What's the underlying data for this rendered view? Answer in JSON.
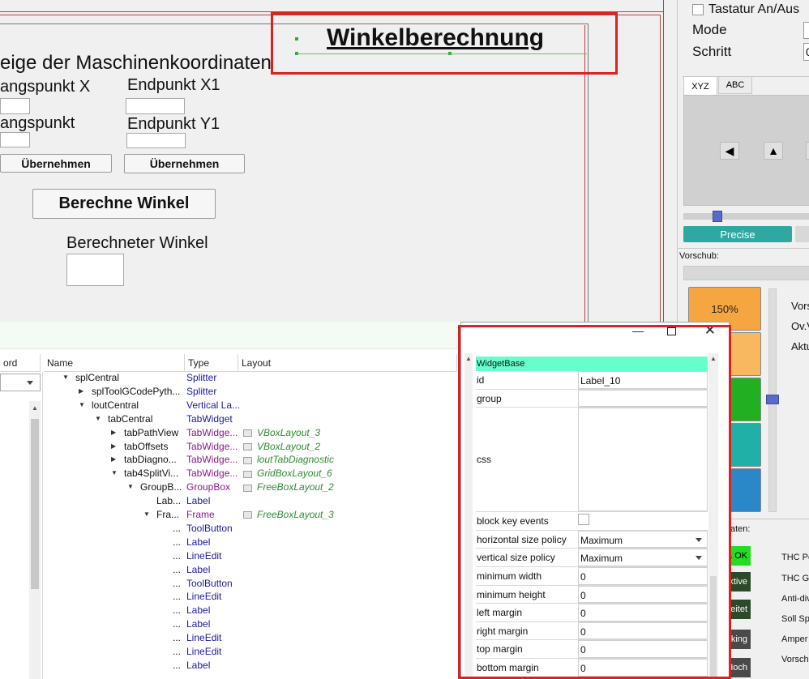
{
  "form": {
    "title": "Winkelberechnung",
    "section_heading": "eige der Maschinenkoordinaten",
    "start_x_label": "angspunkt X",
    "end_x_label": "Endpunkt X1",
    "start_y_label": "angspunkt",
    "end_y_label": "Endpunkt Y1",
    "apply_left_label": "Übernehmen",
    "apply_right_label": "Übernehmen",
    "calculate_label": "Berechne Winkel",
    "result_label": "Berechneter Winkel"
  },
  "machine_panel": {
    "keyboard_toggle_label": "Tastatur An/Aus",
    "mode_label": "Mode",
    "step_label": "Schritt",
    "step_value": "0",
    "tabs": [
      "XYZ",
      "ABC"
    ],
    "precise_label": "Precise",
    "feed_label": "Vorschub:",
    "overrides": [
      "150%",
      "%",
      "%",
      "%",
      "%"
    ],
    "side_labels": [
      "Vors",
      "Ov.V",
      "Aktu"
    ],
    "data_label": "aten:",
    "thc_status": [
      {
        "text": "a OK",
        "label": "THC Po"
      },
      {
        "text": "ist Aktive",
        "label": "THC Ge"
      },
      {
        "text": "rbeitet",
        "label": "Anti-div"
      },
      {
        "text": "s blocking",
        "label": "Soll Spa"
      },
      {
        "text": "r Hoch",
        "label": "Amper"
      },
      {
        "text": "",
        "label": "Vorsch"
      }
    ],
    "colors": {
      "accent": "#2ea8a0",
      "green": "#22c022",
      "orange": "#f5a640",
      "teal": "#20b0a8",
      "blue": "#2a88c8"
    }
  },
  "inspector": {
    "columns": [
      "ord",
      "Name",
      "Type",
      "Layout"
    ],
    "tree": [
      {
        "indent": 0,
        "arrow": "down",
        "name": "splCentral",
        "type": "Splitter",
        "type_color": "#1a1aa0",
        "layout": ""
      },
      {
        "indent": 1,
        "arrow": "right",
        "name": "splToolGCodePyth...",
        "type": "Splitter",
        "type_color": "#1a1aa0",
        "layout": ""
      },
      {
        "indent": 1,
        "arrow": "down",
        "name": "loutCentral",
        "type": "Vertical La...",
        "type_color": "#1a1aa0",
        "layout": ""
      },
      {
        "indent": 2,
        "arrow": "down",
        "name": "tabCentral",
        "type": "TabWidget",
        "type_color": "#1a1aa0",
        "layout": ""
      },
      {
        "indent": 3,
        "arrow": "right",
        "name": "tabPathView",
        "type": "TabWidge...",
        "type_color": "#8a1a8a",
        "layout": "VBoxLayout_3"
      },
      {
        "indent": 3,
        "arrow": "right",
        "name": "tabOffsets",
        "type": "TabWidge...",
        "type_color": "#8a1a8a",
        "layout": "VBoxLayout_2"
      },
      {
        "indent": 3,
        "arrow": "right",
        "name": "tabDiagno...",
        "type": "TabWidge...",
        "type_color": "#8a1a8a",
        "layout": "loutTabDiagnostic"
      },
      {
        "indent": 3,
        "arrow": "down",
        "name": "tab4SplitVi...",
        "type": "TabWidge...",
        "type_color": "#8a1a8a",
        "layout": "GridBoxLayout_6"
      },
      {
        "indent": 4,
        "arrow": "down",
        "name": "GroupB...",
        "type": "GroupBox",
        "type_color": "#8a1a8a",
        "layout": "FreeBoxLayout_2"
      },
      {
        "indent": 5,
        "arrow": "",
        "name": "Lab...",
        "type": "Label",
        "type_color": "#1a1aa0",
        "layout": ""
      },
      {
        "indent": 5,
        "arrow": "down",
        "name": "Fra...",
        "type": "Frame",
        "type_color": "#8a1a8a",
        "layout": "FreeBoxLayout_3"
      },
      {
        "indent": 6,
        "arrow": "",
        "name": "...",
        "type": "ToolButton",
        "type_color": "#1a1aa0",
        "layout": ""
      },
      {
        "indent": 6,
        "arrow": "",
        "name": "...",
        "type": "Label",
        "type_color": "#1a1aa0",
        "layout": ""
      },
      {
        "indent": 6,
        "arrow": "",
        "name": "...",
        "type": "LineEdit",
        "type_color": "#1a1aa0",
        "layout": ""
      },
      {
        "indent": 6,
        "arrow": "",
        "name": "...",
        "type": "Label",
        "type_color": "#1a1aa0",
        "layout": ""
      },
      {
        "indent": 6,
        "arrow": "",
        "name": "...",
        "type": "ToolButton",
        "type_color": "#1a1aa0",
        "layout": ""
      },
      {
        "indent": 6,
        "arrow": "",
        "name": "...",
        "type": "LineEdit",
        "type_color": "#1a1aa0",
        "layout": ""
      },
      {
        "indent": 6,
        "arrow": "",
        "name": "...",
        "type": "Label",
        "type_color": "#1a1aa0",
        "layout": ""
      },
      {
        "indent": 6,
        "arrow": "",
        "name": "...",
        "type": "Label",
        "type_color": "#1a1aa0",
        "layout": ""
      },
      {
        "indent": 6,
        "arrow": "",
        "name": "...",
        "type": "LineEdit",
        "type_color": "#1a1aa0",
        "layout": ""
      },
      {
        "indent": 6,
        "arrow": "",
        "name": "...",
        "type": "LineEdit",
        "type_color": "#1a1aa0",
        "layout": ""
      },
      {
        "indent": 6,
        "arrow": "",
        "name": "...",
        "type": "Label",
        "type_color": "#1a1aa0",
        "layout": ""
      }
    ]
  },
  "properties": {
    "group_header": "WidgetBase",
    "rows": [
      {
        "key": "id",
        "value": "Label_10",
        "kind": "text"
      },
      {
        "key": "group",
        "value": "",
        "kind": "text"
      },
      {
        "key": "css",
        "value": "",
        "kind": "multiline"
      },
      {
        "key": "block key events",
        "value": "",
        "kind": "checkbox"
      },
      {
        "key": "horizontal size policy",
        "value": "Maximum",
        "kind": "combo"
      },
      {
        "key": "vertical size policy",
        "value": "Maximum",
        "kind": "combo"
      },
      {
        "key": "minimum width",
        "value": "0",
        "kind": "text"
      },
      {
        "key": "minimum height",
        "value": "0",
        "kind": "text"
      },
      {
        "key": "left margin",
        "value": "0",
        "kind": "text"
      },
      {
        "key": "right margin",
        "value": "0",
        "kind": "text"
      },
      {
        "key": "top margin",
        "value": "0",
        "kind": "text"
      },
      {
        "key": "bottom margin",
        "value": "0",
        "kind": "text"
      }
    ]
  }
}
